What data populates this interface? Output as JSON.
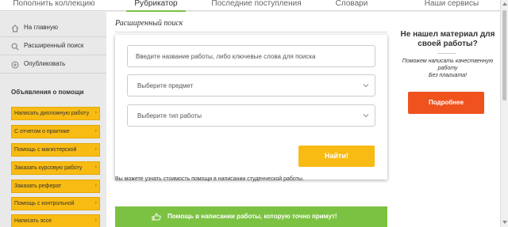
{
  "nav": {
    "tabs": [
      {
        "label": "Пополнить коллекцию"
      },
      {
        "label": "Рубрикатор"
      },
      {
        "label": "Последние поступления"
      },
      {
        "label": "Словари"
      },
      {
        "label": "Наши сервисы"
      }
    ],
    "active": "Рубрикатор",
    "accent_color": "#7cc242"
  },
  "sidebar": {
    "links": [
      {
        "label": "На главную",
        "icon": "home-icon"
      },
      {
        "label": "Расширенный поиск",
        "icon": "search-icon"
      },
      {
        "label": "Опубликовать",
        "icon": "plus-circle-icon"
      }
    ],
    "ads_title": "Объявления о помощи",
    "ads": [
      {
        "label": "Написать дипломную работу"
      },
      {
        "label": "С отчетом о практике"
      },
      {
        "label": "Помощь с магистерской"
      },
      {
        "label": "Заказать курсовую работу"
      },
      {
        "label": "Заказать реферат"
      },
      {
        "label": "Помощь с контрольной"
      },
      {
        "label": "Написать эссе"
      }
    ],
    "ad_color": "#f8bb14"
  },
  "search": {
    "title": "Расширенный поиск",
    "query_placeholder": "Введите название работы, либо ключевые слова для поиска",
    "subject_placeholder": "Выберите предмет",
    "type_placeholder": "Выберите тип работы",
    "find_label": "Найти!",
    "info": "Вы можете узнать стоимость помощи в написании студенческой работы.",
    "cta_label": "Помощь в написании работы, которую точно примут!",
    "cta_icon": "thumbs-up-icon",
    "cta_color": "#7cc242"
  },
  "promo": {
    "title_line1": "Не нашел материал для",
    "title_line2": "своей работы?",
    "text_line1": "Поможем написать качественную",
    "text_line2": "работу",
    "text_line3": "Без плагиата!",
    "button_label": "Подробнее",
    "button_color": "#f0521e"
  }
}
